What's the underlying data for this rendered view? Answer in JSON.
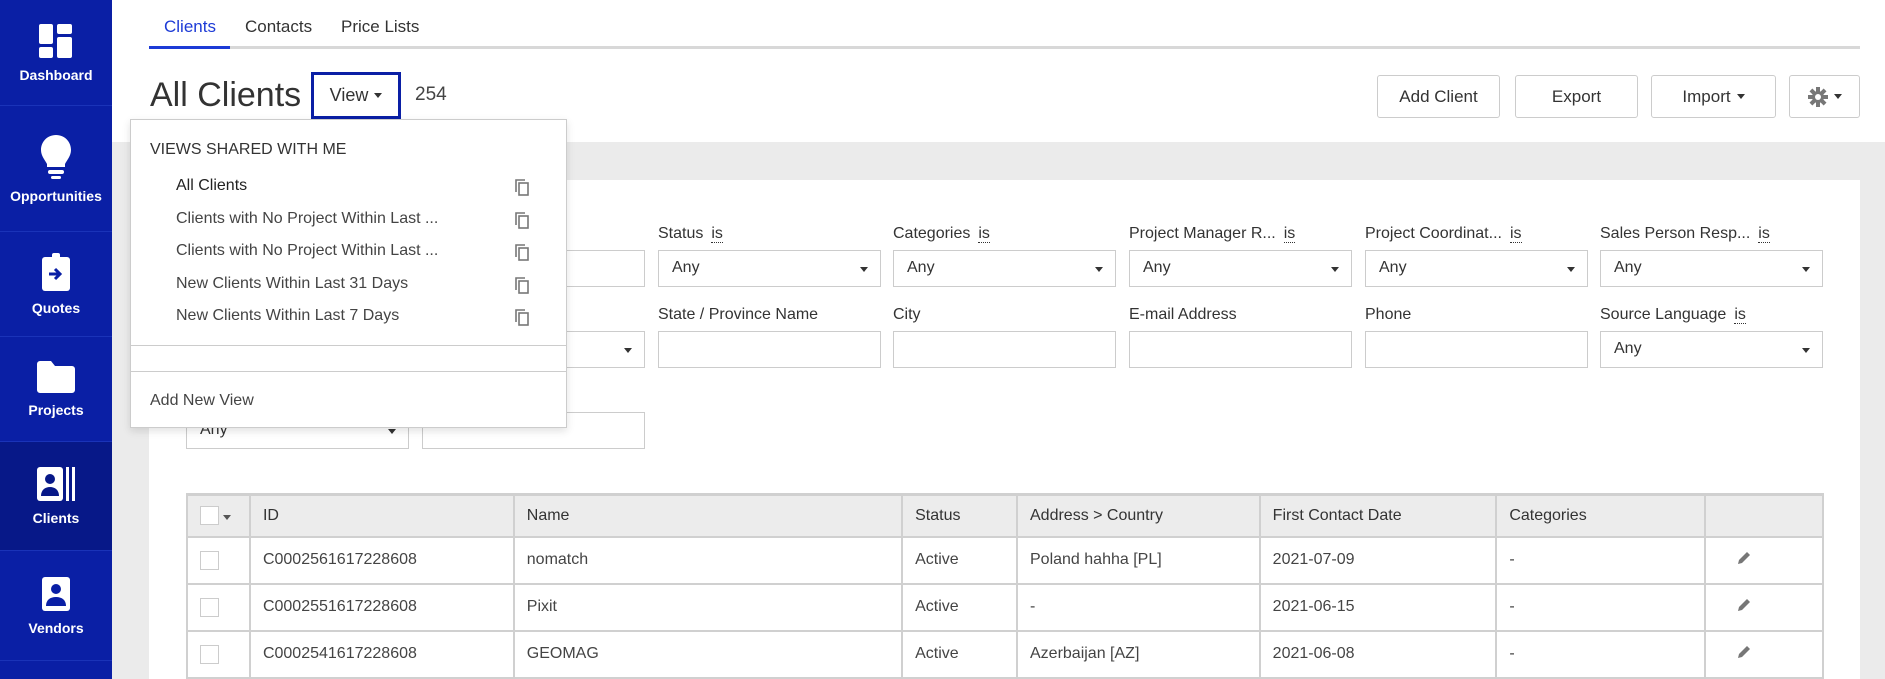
{
  "sidebar": {
    "items": [
      {
        "label": "Dashboard",
        "icon": "dashboard-icon"
      },
      {
        "label": "Opportunities",
        "icon": "lightbulb-icon"
      },
      {
        "label": "Quotes",
        "icon": "clipboard-arrow-icon"
      },
      {
        "label": "Projects",
        "icon": "folder-icon"
      },
      {
        "label": "Clients",
        "icon": "contacts-icon",
        "active": true
      },
      {
        "label": "Vendors",
        "icon": "person-badge-icon"
      }
    ],
    "color": "#0a1fa5",
    "active_color": "#071888"
  },
  "tabs": [
    {
      "label": "Clients",
      "active": true
    },
    {
      "label": "Contacts"
    },
    {
      "label": "Price Lists"
    }
  ],
  "header": {
    "title": "All Clients",
    "view_label": "View",
    "count": "254"
  },
  "toolbar": {
    "add_client": "Add Client",
    "export": "Export",
    "import": "Import",
    "settings_icon": "gear-icon"
  },
  "view_menu": {
    "section_title": "VIEWS SHARED WITH ME",
    "items": [
      "All Clients",
      "Clients with No Project Within Last ...",
      "Clients with No Project Within Last ...",
      "New Clients Within Last 31 Days",
      "New Clients Within Last 7 Days"
    ],
    "add_new": "Add New View"
  },
  "filters": {
    "is_label": "is",
    "row1": [
      {
        "label": "Status",
        "value": "Any"
      },
      {
        "label": "Categories",
        "value": "Any"
      },
      {
        "label": "Project Manager R...",
        "value": "Any"
      },
      {
        "label": "Project Coordinat...",
        "value": "Any"
      },
      {
        "label": "Sales Person Resp...",
        "value": "Any"
      }
    ],
    "row2": [
      {
        "label": "State / Province Name"
      },
      {
        "label": "City"
      },
      {
        "label": "E-mail Address"
      },
      {
        "label": "Phone"
      },
      {
        "label": "Source Language",
        "value": "Any"
      }
    ],
    "row3_select": "Any"
  },
  "table": {
    "columns": [
      "ID",
      "Name",
      "Status",
      "Address > Country",
      "First Contact Date",
      "Categories"
    ],
    "rows": [
      [
        "C0002561617228608",
        "nomatch",
        "Active",
        "Poland hahha [PL]",
        "2021-07-09",
        "-"
      ],
      [
        "C0002551617228608",
        "Pixit",
        "Active",
        "-",
        "2021-06-15",
        "-"
      ],
      [
        "C0002541617228608",
        "GEOMAG",
        "Active",
        "Azerbaijan [AZ]",
        "2021-06-08",
        "-"
      ]
    ]
  }
}
